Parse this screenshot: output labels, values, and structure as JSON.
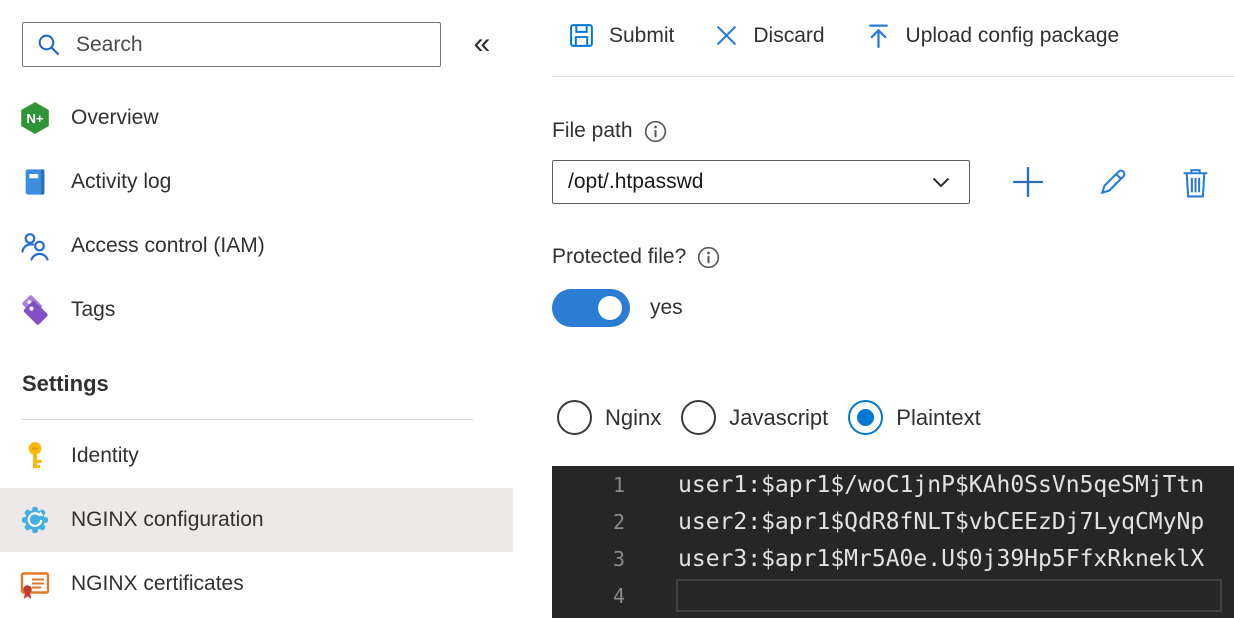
{
  "sidebar": {
    "search": {
      "placeholder": "Search"
    },
    "collapse_glyph": "«",
    "items": [
      {
        "label": "Overview",
        "icon": "nginx-plus-icon"
      },
      {
        "label": "Activity log",
        "icon": "activity-log-icon"
      },
      {
        "label": "Access control (IAM)",
        "icon": "access-control-icon"
      },
      {
        "label": "Tags",
        "icon": "tags-icon"
      }
    ],
    "section_title": "Settings",
    "settings_items": [
      {
        "label": "Identity",
        "icon": "key-icon",
        "selected": false
      },
      {
        "label": "NGINX configuration",
        "icon": "gear-icon",
        "selected": true
      },
      {
        "label": "NGINX certificates",
        "icon": "certificate-icon",
        "selected": false
      }
    ]
  },
  "toolbar": {
    "submit_label": "Submit",
    "discard_label": "Discard",
    "upload_label": "Upload config package"
  },
  "form": {
    "file_path": {
      "label": "File path",
      "value": "/opt/.htpasswd"
    },
    "protected_file": {
      "label": "Protected file?",
      "state_label": "yes",
      "enabled": true
    },
    "syntax_options": [
      {
        "label": "Nginx",
        "selected": false
      },
      {
        "label": "Javascript",
        "selected": false
      },
      {
        "label": "Plaintext",
        "selected": true
      }
    ]
  },
  "editor": {
    "lines": [
      {
        "number": "1",
        "content": "user1:$apr1$/woC1jnP$KAh0SsVn5qeSMjTtn"
      },
      {
        "number": "2",
        "content": "user2:$apr1$QdR8fNLT$vbCEEzDj7LyqCMyNp"
      },
      {
        "number": "3",
        "content": "user3:$apr1$Mr5A0e.U$0j39Hp5FfxRkneklX"
      },
      {
        "number": "4",
        "content": ""
      }
    ],
    "active_line": 4
  },
  "colors": {
    "accent": "#0078d4",
    "toggle_on": "#2b7cd3",
    "selected_row_background": "#eceae8",
    "editor_background": "#262626",
    "editor_text": "#e2e2e2",
    "editor_line_numbers": "#8a8a8a"
  }
}
